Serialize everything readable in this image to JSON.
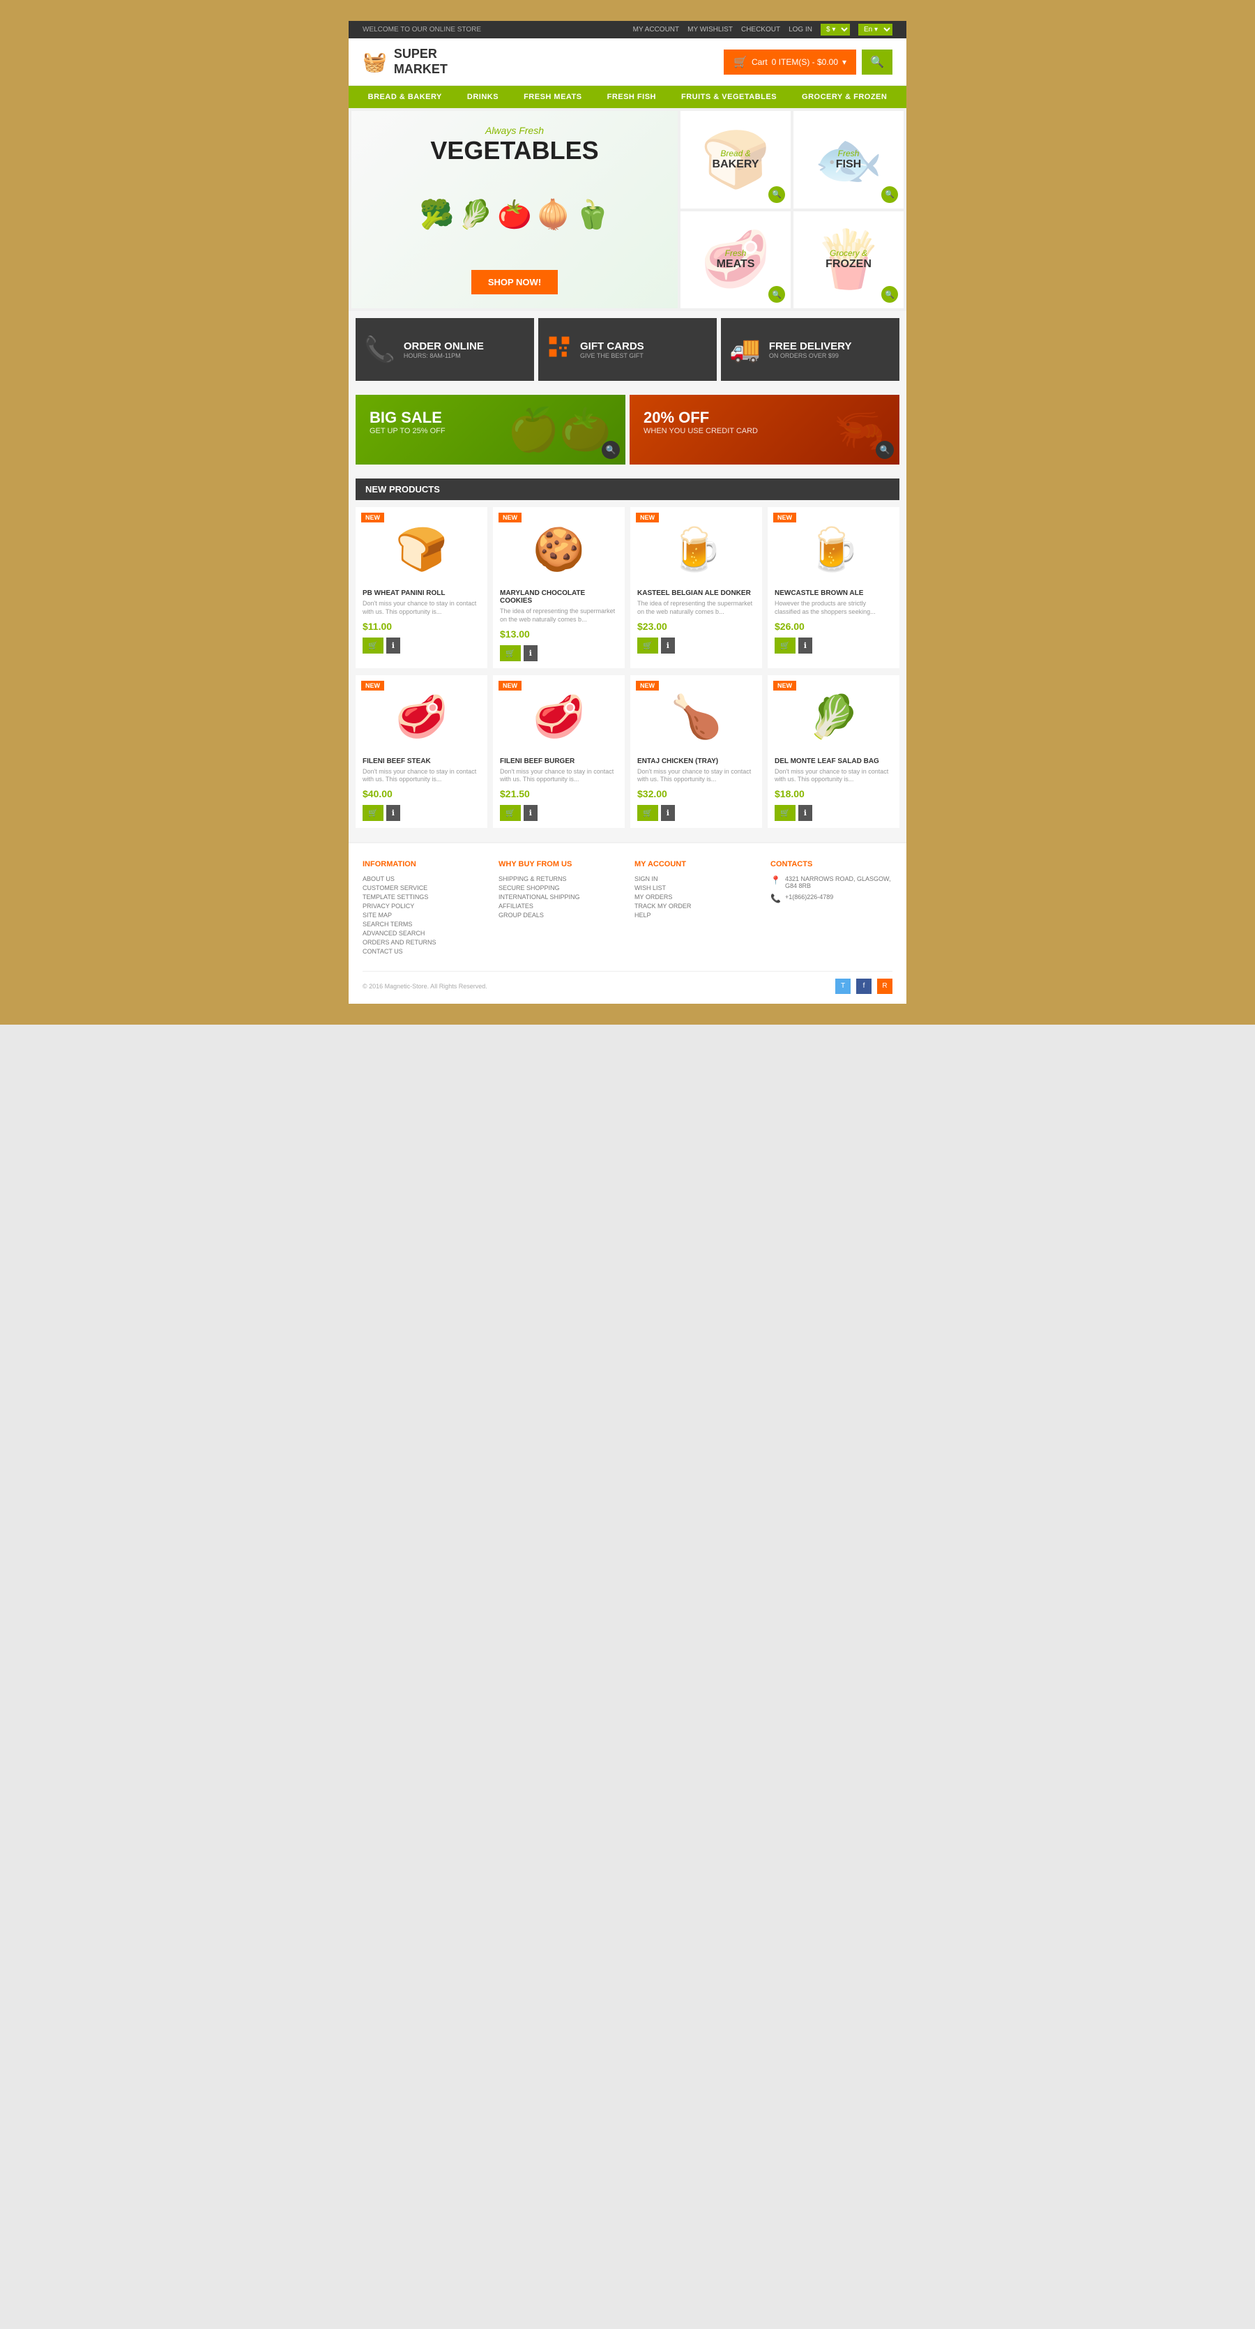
{
  "topbar": {
    "welcome": "WELCOME TO OUR ONLINE STORE",
    "links": [
      "MY ACCOUNT",
      "MY WISHLIST",
      "CHECKOUT",
      "LOG IN"
    ],
    "currency": "$",
    "language": "En"
  },
  "header": {
    "logo_line1": "SUPER",
    "logo_line2": "MARKET",
    "cart_label": "Cart",
    "cart_items": "0 ITEM(S) - $0.00",
    "search_tooltip": "Search"
  },
  "nav": {
    "items": [
      {
        "label": "BREAD & BAKERY"
      },
      {
        "label": "DRINKS"
      },
      {
        "label": "FRESH MEATS"
      },
      {
        "label": "FRESH FISH"
      },
      {
        "label": "FRUITS & VEGETABLES"
      },
      {
        "label": "GROCERY & FROZEN"
      }
    ]
  },
  "hero": {
    "subtitle": "Always Fresh",
    "title": "VEGETABLES",
    "shop_now": "SHOP NOW!",
    "cards": [
      {
        "line1": "Bread &",
        "line2": "BAKERY",
        "emoji": "🍞"
      },
      {
        "line1": "Fresh",
        "line2": "FISH",
        "emoji": "🐟"
      },
      {
        "line1": "Fresh",
        "line2": "MEATS",
        "emoji": "🥩"
      },
      {
        "line1": "Grocery &",
        "line2": "FROZEN",
        "emoji": "🍟"
      }
    ]
  },
  "features": [
    {
      "icon": "📞",
      "title": "ORDER ONLINE",
      "subtitle": "HOURS: 8AM-11PM"
    },
    {
      "icon": "⬛",
      "title": "GIFT CARDS",
      "subtitle": "GIVE THE BEST GIFT"
    },
    {
      "icon": "🚚",
      "title": "FREE DELIVERY",
      "subtitle": "ON ORDERS OVER $99"
    }
  ],
  "promos": [
    {
      "title": "BIG SALE",
      "subtitle": "GET UP TO 25% OFF"
    },
    {
      "title": "20% OFF",
      "subtitle": "WHEN YOU USE CREDIT CARD"
    }
  ],
  "products_section": {
    "title": "NEW PRODUCTS",
    "badge": "NEW",
    "products": [
      {
        "name": "PB WHEAT PANINI ROLL",
        "desc": "Don't miss your chance to stay in contact with us. This opportunity is...",
        "price": "$11.00",
        "emoji": "🍞"
      },
      {
        "name": "MARYLAND CHOCOLATE COOKIES",
        "desc": "The idea of representing the supermarket on the web naturally comes b...",
        "price": "$13.00",
        "emoji": "🍪"
      },
      {
        "name": "KASTEEL BELGIAN ALE DONKER",
        "desc": "The idea of representing the supermarket on the web naturally comes b...",
        "price": "$23.00",
        "emoji": "🍺"
      },
      {
        "name": "NEWCASTLE BROWN ALE",
        "desc": "However the products are strictly classified as the shoppers seeking...",
        "price": "$26.00",
        "emoji": "🍺"
      },
      {
        "name": "FILENI BEEF STEAK",
        "desc": "Don't miss your chance to stay in contact with us. This opportunity is...",
        "price": "$40.00",
        "emoji": "🥩"
      },
      {
        "name": "FILENI BEEF BURGER",
        "desc": "Don't miss your chance to stay in contact with us. This opportunity is...",
        "price": "$21.50",
        "emoji": "🥩"
      },
      {
        "name": "ENTAJ CHICKEN (TRAY)",
        "desc": "Don't miss your chance to stay in contact with us. This opportunity is...",
        "price": "$32.00",
        "emoji": "🍗"
      },
      {
        "name": "DEL MONTE LEAF SALAD BAG",
        "desc": "Don't miss your chance to stay in contact with us. This opportunity is...",
        "price": "$18.00",
        "emoji": "🥬"
      }
    ]
  },
  "footer": {
    "cols": [
      {
        "title": "INFORMATION",
        "links": [
          "ABOUT US",
          "CUSTOMER SERVICE",
          "TEMPLATE SETTINGS",
          "PRIVACY POLICY",
          "SITE MAP",
          "SEARCH TERMS",
          "ADVANCED SEARCH",
          "ORDERS AND RETURNS",
          "CONTACT US"
        ]
      },
      {
        "title": "WHY BUY FROM US",
        "links": [
          "SHIPPING & RETURNS",
          "SECURE SHOPPING",
          "INTERNATIONAL SHIPPING",
          "AFFILIATES",
          "GROUP DEALS"
        ]
      },
      {
        "title": "MY ACCOUNT",
        "links": [
          "SIGN IN",
          "WISH LIST",
          "MY ORDERS",
          "TRACK MY ORDER",
          "HELP"
        ]
      },
      {
        "title": "CONTACTS",
        "address": "4321 NARROWS ROAD, GLASGOW, G84 8RB",
        "phone": "+1(866)226-4789"
      }
    ],
    "copyright": "© 2016 Magnetic-Store. All Rights Reserved.",
    "social": [
      "T",
      "f",
      "RSS"
    ]
  }
}
